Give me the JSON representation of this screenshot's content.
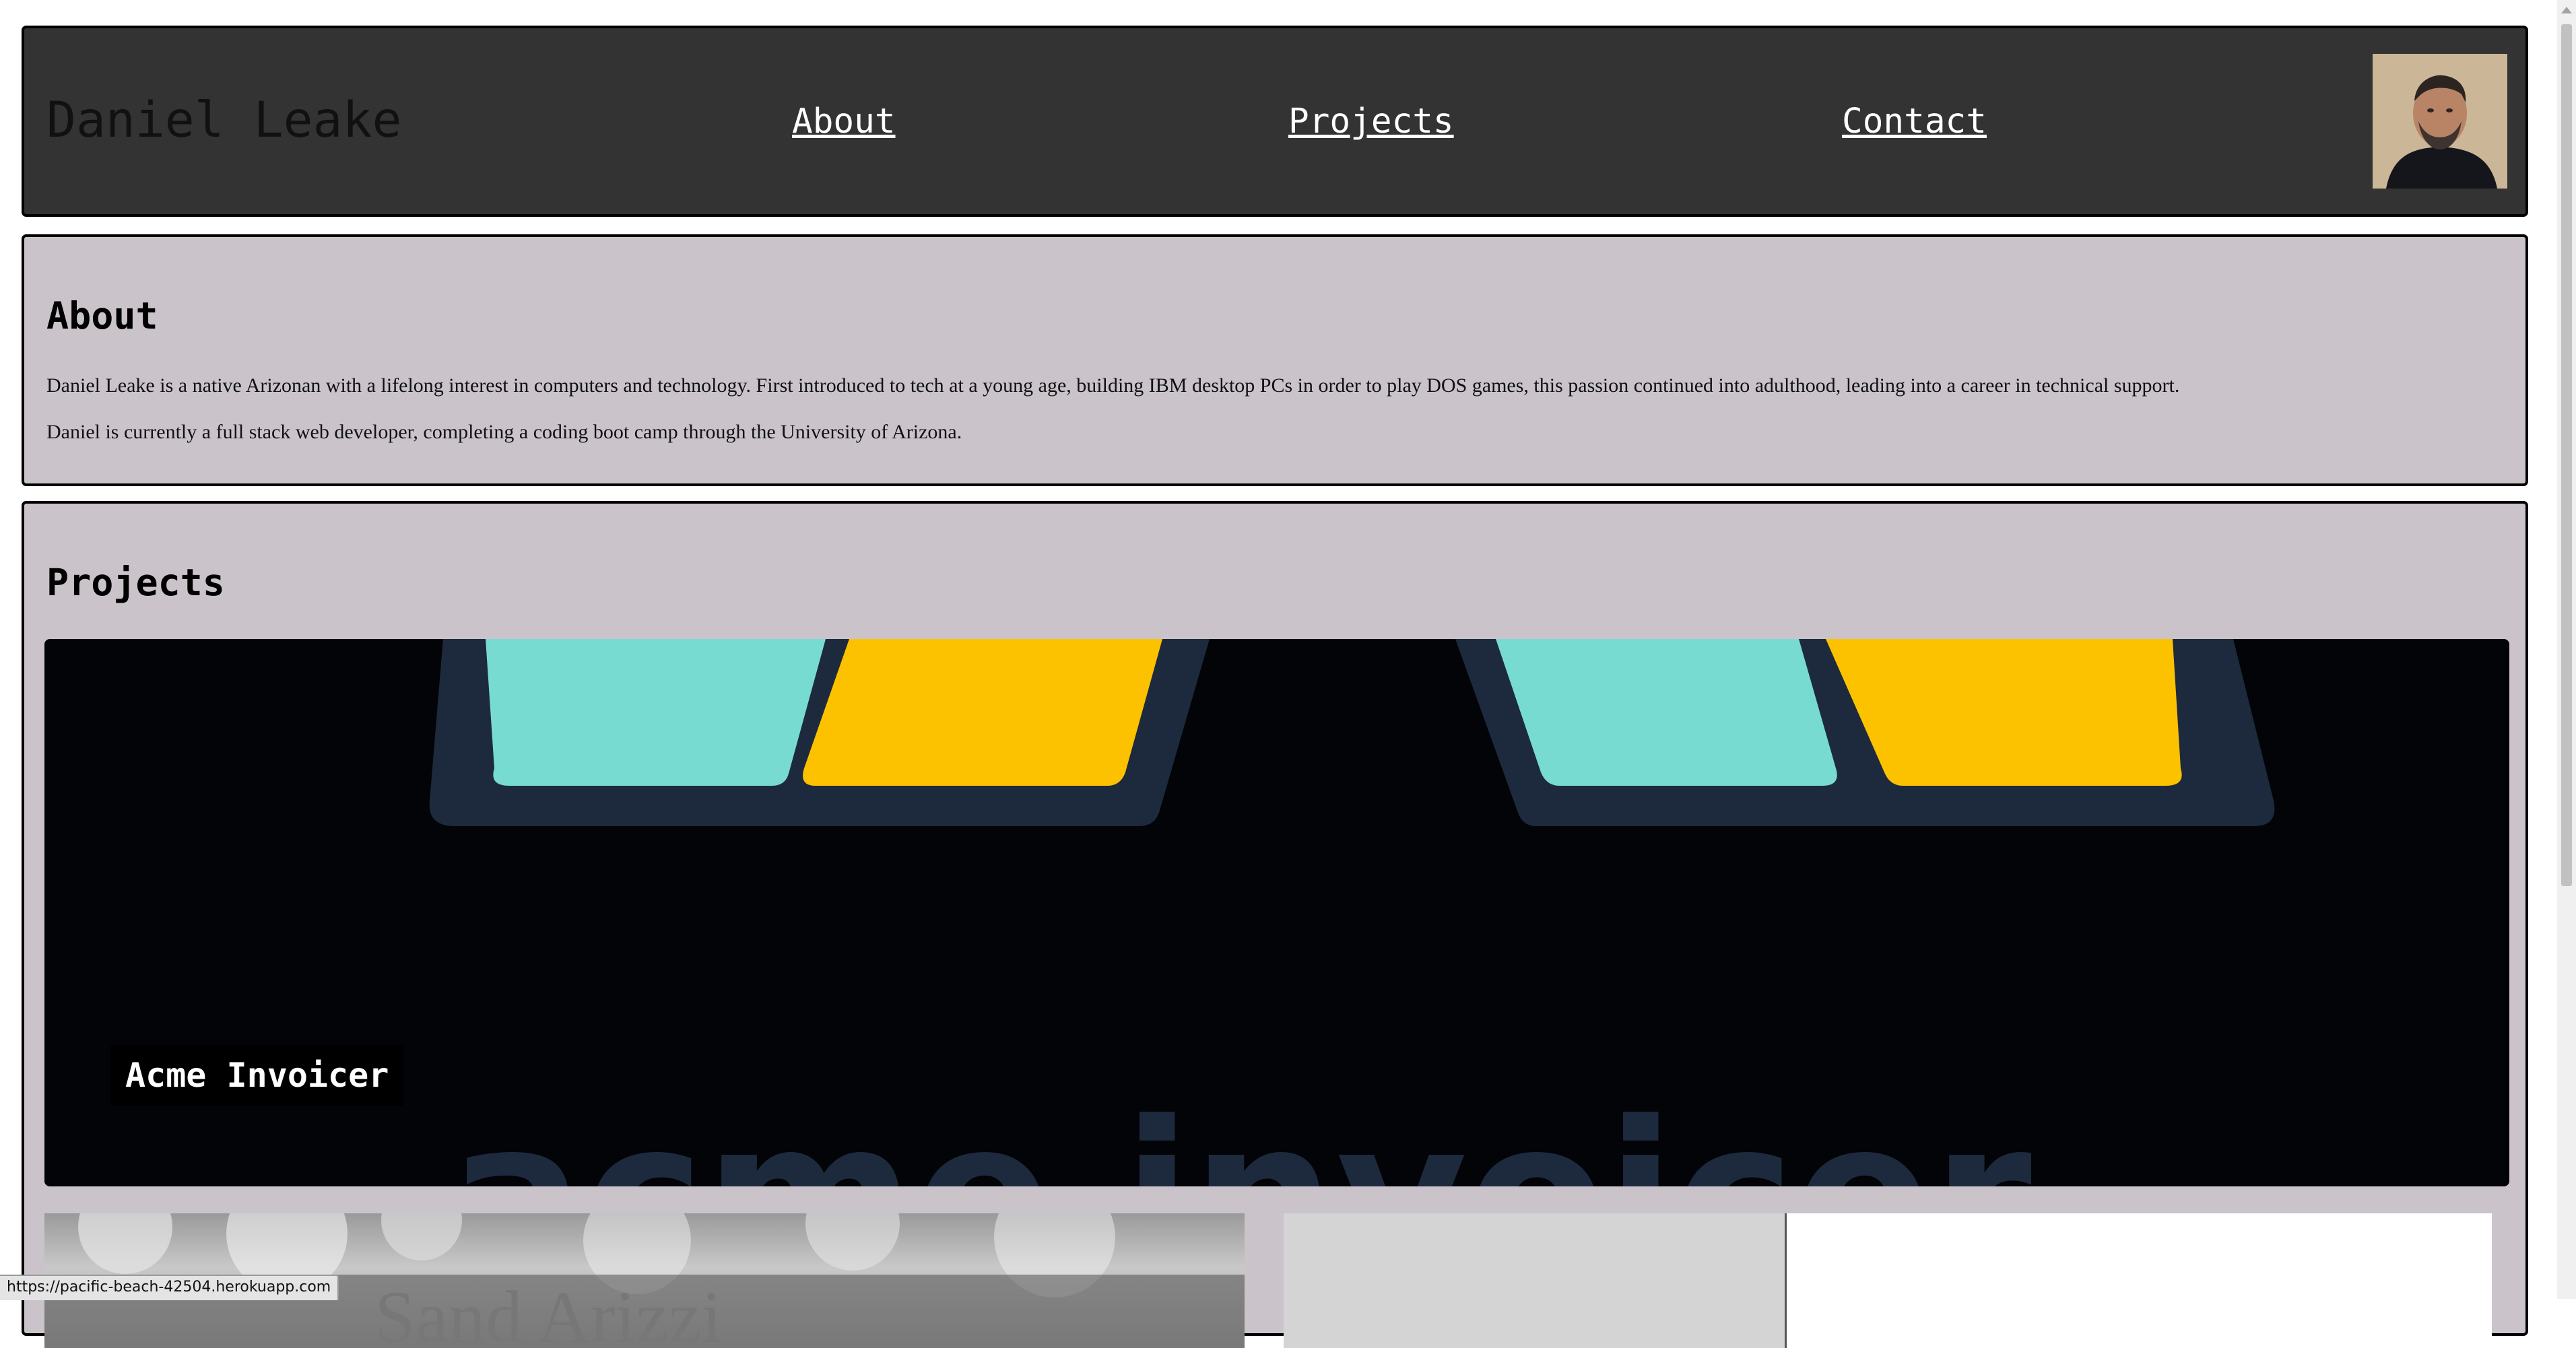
{
  "header": {
    "title": "Daniel Leake",
    "nav": [
      {
        "label": "About"
      },
      {
        "label": "Projects"
      },
      {
        "label": "Contact"
      }
    ]
  },
  "about": {
    "title": "About",
    "paragraphs": [
      "Daniel Leake is a native Arizonan with a lifelong interest in computers and technology. First introduced to tech at a young age, building IBM desktop PCs in order to play DOS games, this passion continued into adulthood, leading into a career in technical support.",
      "Daniel is currently a full stack web developer, completing a coding boot camp through the University of Arizona."
    ]
  },
  "projects": {
    "title": "Projects",
    "featured": {
      "label": "Acme Invoicer",
      "logo_text": "acme invoicer"
    },
    "second_thumb_text": "Sand Arizzi"
  },
  "status_bar": {
    "url": "https://pacific-beach-42504.herokuapp.com"
  },
  "colors": {
    "header_bg": "#333333",
    "section_bg": "#cac4ca",
    "teal": "#78dbd1",
    "yellow": "#fcc200",
    "logo_navy": "#1d2a3d"
  }
}
